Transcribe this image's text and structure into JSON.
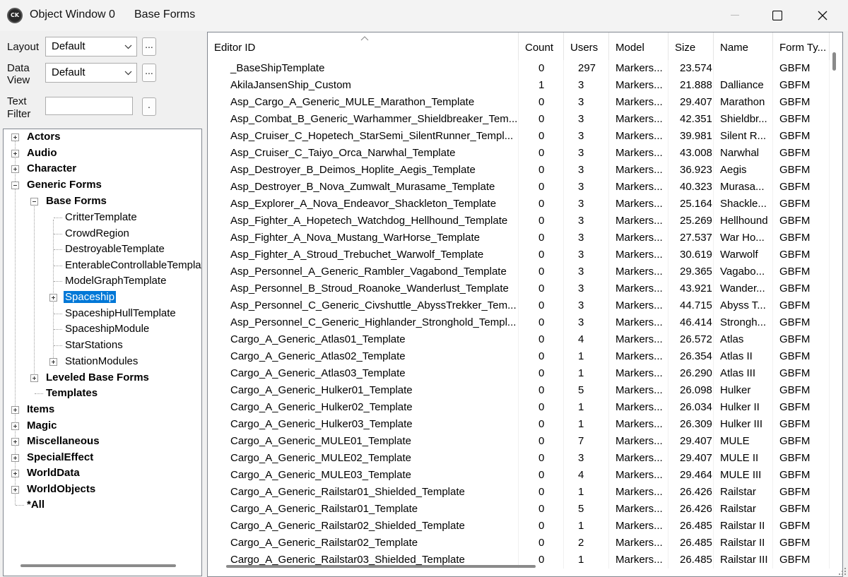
{
  "window": {
    "title": "Object Window 0",
    "subtitle": "Base Forms",
    "icon_text": "CK"
  },
  "left": {
    "layout_label": "Layout",
    "layout_value": "Default",
    "dataview_label_1": "Data",
    "dataview_label_2": "View",
    "dataview_value": "Default",
    "textfilter_label_1": "Text",
    "textfilter_label_2": "Filter",
    "textfilter_value": "",
    "ellipsis": "...",
    "dot": "."
  },
  "tree": {
    "items": [
      {
        "label": "Actors"
      },
      {
        "label": "Audio"
      },
      {
        "label": "Character"
      },
      {
        "label": "Generic Forms"
      },
      {
        "label": "Base Forms"
      },
      {
        "label": "CritterTemplate"
      },
      {
        "label": "CrowdRegion"
      },
      {
        "label": "DestroyableTemplate"
      },
      {
        "label": "EnterableControllableTemplate"
      },
      {
        "label": "ModelGraphTemplate"
      },
      {
        "label": "Spaceship"
      },
      {
        "label": "SpaceshipHullTemplate"
      },
      {
        "label": "SpaceshipModule"
      },
      {
        "label": "StarStations"
      },
      {
        "label": "StationModules"
      },
      {
        "label": "Leveled Base Forms"
      },
      {
        "label": "Templates"
      },
      {
        "label": "Items"
      },
      {
        "label": "Magic"
      },
      {
        "label": "Miscellaneous"
      },
      {
        "label": "SpecialEffect"
      },
      {
        "label": "WorldData"
      },
      {
        "label": "WorldObjects"
      },
      {
        "label": "*All"
      }
    ]
  },
  "grid": {
    "columns": [
      "Editor ID",
      "Count",
      "Users",
      "Model",
      "Size",
      "Name",
      "Form Ty..."
    ],
    "rows": [
      [
        "_BaseShipTemplate",
        "0",
        "297",
        "Markers...",
        "23.574",
        "",
        "GBFM"
      ],
      [
        "AkilaJansenShip_Custom",
        "1",
        "3",
        "Markers...",
        "21.888",
        "Dalliance",
        "GBFM"
      ],
      [
        "Asp_Cargo_A_Generic_MULE_Marathon_Template",
        "0",
        "3",
        "Markers...",
        "29.407",
        "Marathon",
        "GBFM"
      ],
      [
        "Asp_Combat_B_Generic_Warhammer_Shieldbreaker_Tem...",
        "0",
        "3",
        "Markers...",
        "42.351",
        "Shieldbr...",
        "GBFM"
      ],
      [
        "Asp_Cruiser_C_Hopetech_StarSemi_SilentRunner_Templ...",
        "0",
        "3",
        "Markers...",
        "39.981",
        "Silent R...",
        "GBFM"
      ],
      [
        "Asp_Cruiser_C_Taiyo_Orca_Narwhal_Template",
        "0",
        "3",
        "Markers...",
        "43.008",
        "Narwhal",
        "GBFM"
      ],
      [
        "Asp_Destroyer_B_Deimos_Hoplite_Aegis_Template",
        "0",
        "3",
        "Markers...",
        "36.923",
        "Aegis",
        "GBFM"
      ],
      [
        "Asp_Destroyer_B_Nova_Zumwalt_Murasame_Template",
        "0",
        "3",
        "Markers...",
        "40.323",
        "Murasa...",
        "GBFM"
      ],
      [
        "Asp_Explorer_A_Nova_Endeavor_Shackleton_Template",
        "0",
        "3",
        "Markers...",
        "25.164",
        "Shackle...",
        "GBFM"
      ],
      [
        "Asp_Fighter_A_Hopetech_Watchdog_Hellhound_Template",
        "0",
        "3",
        "Markers...",
        "25.269",
        "Hellhound",
        "GBFM"
      ],
      [
        "Asp_Fighter_A_Nova_Mustang_WarHorse_Template",
        "0",
        "3",
        "Markers...",
        "27.537",
        "War Ho...",
        "GBFM"
      ],
      [
        "Asp_Fighter_A_Stroud_Trebuchet_Warwolf_Template",
        "0",
        "3",
        "Markers...",
        "30.619",
        "Warwolf",
        "GBFM"
      ],
      [
        "Asp_Personnel_A_Generic_Rambler_Vagabond_Template",
        "0",
        "3",
        "Markers...",
        "29.365",
        "Vagabo...",
        "GBFM"
      ],
      [
        "Asp_Personnel_B_Stroud_Roanoke_Wanderlust_Template",
        "0",
        "3",
        "Markers...",
        "43.921",
        "Wander...",
        "GBFM"
      ],
      [
        "Asp_Personnel_C_Generic_Civshuttle_AbyssTrekker_Tem...",
        "0",
        "3",
        "Markers...",
        "44.715",
        "Abyss T...",
        "GBFM"
      ],
      [
        "Asp_Personnel_C_Generic_Highlander_Stronghold_Templ...",
        "0",
        "3",
        "Markers...",
        "46.414",
        "Strongh...",
        "GBFM"
      ],
      [
        "Cargo_A_Generic_Atlas01_Template",
        "0",
        "4",
        "Markers...",
        "26.572",
        "Atlas",
        "GBFM"
      ],
      [
        "Cargo_A_Generic_Atlas02_Template",
        "0",
        "1",
        "Markers...",
        "26.354",
        "Atlas II",
        "GBFM"
      ],
      [
        "Cargo_A_Generic_Atlas03_Template",
        "0",
        "1",
        "Markers...",
        "26.290",
        "Atlas III",
        "GBFM"
      ],
      [
        "Cargo_A_Generic_Hulker01_Template",
        "0",
        "5",
        "Markers...",
        "26.098",
        "Hulker",
        "GBFM"
      ],
      [
        "Cargo_A_Generic_Hulker02_Template",
        "0",
        "1",
        "Markers...",
        "26.034",
        "Hulker II",
        "GBFM"
      ],
      [
        "Cargo_A_Generic_Hulker03_Template",
        "0",
        "1",
        "Markers...",
        "26.309",
        "Hulker III",
        "GBFM"
      ],
      [
        "Cargo_A_Generic_MULE01_Template",
        "0",
        "7",
        "Markers...",
        "29.407",
        "MULE",
        "GBFM"
      ],
      [
        "Cargo_A_Generic_MULE02_Template",
        "0",
        "3",
        "Markers...",
        "29.407",
        "MULE II",
        "GBFM"
      ],
      [
        "Cargo_A_Generic_MULE03_Template",
        "0",
        "4",
        "Markers...",
        "29.464",
        "MULE III",
        "GBFM"
      ],
      [
        "Cargo_A_Generic_Railstar01_Shielded_Template",
        "0",
        "1",
        "Markers...",
        "26.426",
        "Railstar",
        "GBFM"
      ],
      [
        "Cargo_A_Generic_Railstar01_Template",
        "0",
        "5",
        "Markers...",
        "26.426",
        "Railstar",
        "GBFM"
      ],
      [
        "Cargo_A_Generic_Railstar02_Shielded_Template",
        "0",
        "1",
        "Markers...",
        "26.485",
        "Railstar II",
        "GBFM"
      ],
      [
        "Cargo_A_Generic_Railstar02_Template",
        "0",
        "2",
        "Markers...",
        "26.485",
        "Railstar II",
        "GBFM"
      ],
      [
        "Cargo_A_Generic_Railstar03_Shielded_Template",
        "0",
        "1",
        "Markers...",
        "26.485",
        "Railstar III",
        "GBFM"
      ]
    ]
  }
}
